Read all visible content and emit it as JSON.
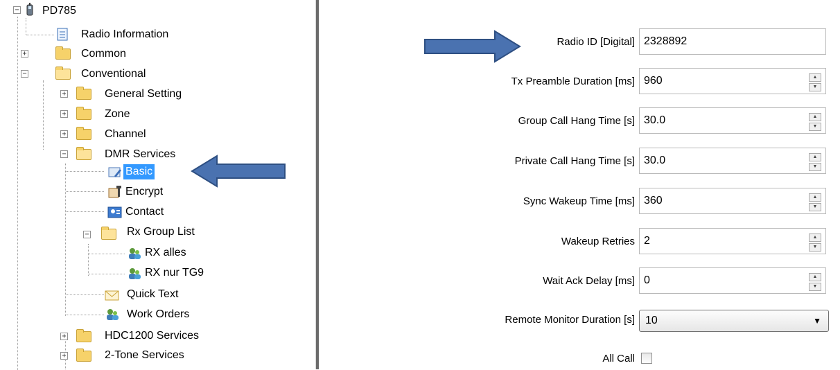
{
  "tree": {
    "root": "PD785",
    "items": [
      {
        "label": "Radio Information"
      },
      {
        "label": "Common"
      },
      {
        "label": "Conventional"
      },
      {
        "label": "General Setting"
      },
      {
        "label": "Zone"
      },
      {
        "label": "Channel"
      },
      {
        "label": "DMR Services"
      },
      {
        "label": "Basic"
      },
      {
        "label": "Encrypt"
      },
      {
        "label": "Contact"
      },
      {
        "label": "Rx Group List"
      },
      {
        "label": "RX alles"
      },
      {
        "label": "RX nur TG9"
      },
      {
        "label": "Quick Text"
      },
      {
        "label": "Work Orders"
      },
      {
        "label": "HDC1200 Services"
      },
      {
        "label": "2-Tone Services"
      }
    ]
  },
  "form": {
    "fields": [
      {
        "label": "Radio ID [Digital]",
        "value": "2328892"
      },
      {
        "label": "Tx Preamble Duration [ms]",
        "value": "960"
      },
      {
        "label": "Group Call Hang Time [s]",
        "value": "30.0"
      },
      {
        "label": "Private Call Hang Time [s]",
        "value": "30.0"
      },
      {
        "label": "Sync Wakeup Time [ms]",
        "value": "360"
      },
      {
        "label": "Wakeup Retries",
        "value": "2"
      },
      {
        "label": "Wait Ack Delay [ms]",
        "value": "0"
      }
    ],
    "remote_monitor": {
      "label": "Remote Monitor Duration [s]",
      "value": "10"
    },
    "all_call": {
      "label": "All Call"
    }
  },
  "colors": {
    "arrow": "#4a72b0",
    "arrow_border": "#2e4f82",
    "selection": "#3399ff"
  },
  "icons": {
    "expand": "+",
    "collapse": "−",
    "dropdown": "▼",
    "spin_up": "▲",
    "spin_down": "▼"
  }
}
